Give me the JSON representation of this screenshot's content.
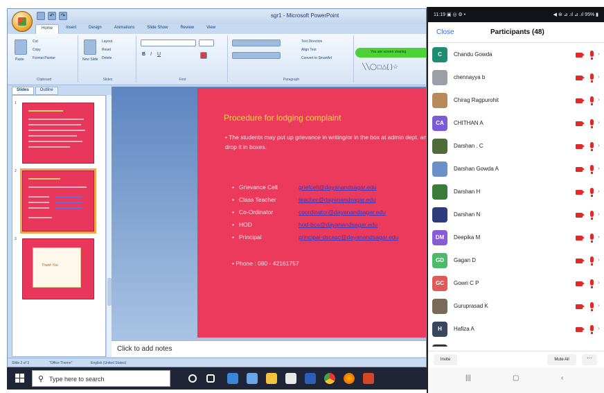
{
  "powerpoint": {
    "window_title": "sgr1 - Microsoft PowerPoint",
    "ribbon_tabs": [
      "Home",
      "Insert",
      "Design",
      "Animations",
      "Slide Show",
      "Review",
      "View"
    ],
    "clipboard": {
      "paste": "Paste",
      "cut": "Cut",
      "copy": "Copy",
      "format_painter": "Format Painter",
      "group": "Clipboard"
    },
    "slides_group": {
      "new_slide": "New Slide",
      "layout": "Layout",
      "reset": "Reset",
      "delete": "Delete",
      "group": "Slides"
    },
    "font_group": "Font",
    "paragraph_group": {
      "text_direction": "Text Direction",
      "align_text": "Align Text",
      "convert_smartart": "Convert to SmartArt",
      "group": "Paragraph"
    },
    "share_banner": "You are screen sharing",
    "pane_tabs": [
      "Slides",
      "Outline"
    ],
    "thumb_numbers": [
      "1",
      "2",
      "3"
    ],
    "thumb_card_text": "Thank You",
    "slide": {
      "title": "Procedure for lodging complaint",
      "intro": "The students may put up grievance in writing/or in the box at admin dept. and drop it in boxes.",
      "contacts": [
        {
          "label": "Grievance Cell",
          "email": "griefcell@dayanandsagar.edu"
        },
        {
          "label": "Class Teacher",
          "email": "teacher@dayanandsagar.edu"
        },
        {
          "label": "Co-Ordinator",
          "email": "coordinator@dayanandsagar.edu"
        },
        {
          "label": "HOD",
          "email": "hod-bca@dayanandsagar.edu"
        },
        {
          "label": "Principal",
          "email": "principal-dscasc@dayanandsagar.edu"
        }
      ],
      "phone": "Phone : 080 - 42161757"
    },
    "notes_placeholder": "Click to add notes",
    "status": {
      "slide": "Slide 2 of 3",
      "theme": "\"Office Theme\"",
      "language": "English (United States)"
    }
  },
  "taskbar": {
    "search_placeholder": "Type here to search",
    "apps": [
      "task-view",
      "edge",
      "file-explorer",
      "mail",
      "store",
      "word",
      "chrome",
      "firefox",
      "powerpoint"
    ]
  },
  "phone": {
    "status_left": "11:19 ▣ ◎ ⚙ •",
    "status_right": "◀ ⊛ ⊿ .ıl ⊿ .ıl 95% ▮",
    "close_label": "Close",
    "participants_title": "Participants (48)",
    "participants": [
      {
        "name": "Chandu Gowda",
        "initials": "C",
        "color": "#1e8c6e"
      },
      {
        "name": "chennayya b",
        "initials": "",
        "color": "#9aa0a6"
      },
      {
        "name": "Chirag Ragpurohit",
        "initials": "",
        "color": "#b8895a"
      },
      {
        "name": "CHITHAN A",
        "initials": "CA",
        "color": "#7c5cd6"
      },
      {
        "name": "Darshan . C",
        "initials": "",
        "color": "#4e6b3a"
      },
      {
        "name": "Darshan Gowda A",
        "initials": "",
        "color": "#6b8fc7"
      },
      {
        "name": "Darshan H",
        "initials": "",
        "color": "#3a7c3a"
      },
      {
        "name": "Darshan N",
        "initials": "",
        "color": "#2f3a7c"
      },
      {
        "name": "Deepika M",
        "initials": "DM",
        "color": "#8a5bd6"
      },
      {
        "name": "Gagan D",
        "initials": "GD",
        "color": "#4cba6a"
      },
      {
        "name": "Gowri C P",
        "initials": "GC",
        "color": "#e05a5a"
      },
      {
        "name": "Guruprasad K",
        "initials": "",
        "color": "#7a6a5a"
      },
      {
        "name": "Hafiza A",
        "initials": "H",
        "color": "#3a4660"
      },
      {
        "name": "",
        "initials": "",
        "color": "#333333"
      }
    ],
    "invite_label": "Invite",
    "mute_all_label": "Mute All",
    "more_label": "···",
    "nav": [
      "|||",
      "▢",
      "‹"
    ]
  }
}
